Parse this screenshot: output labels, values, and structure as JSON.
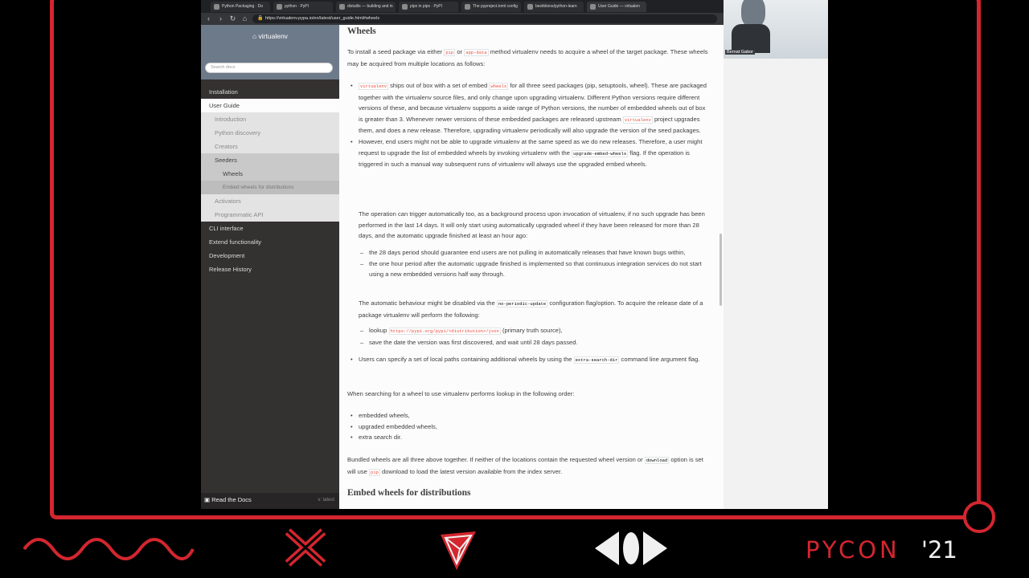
{
  "browser": {
    "tabs": [
      "Python Packaging · Do",
      "python · PyPI",
      "distutils — building and in",
      "pipx in pipx · PyPI",
      "The pypreject.toml config",
      "bestktions/python-learn",
      "User Guide — virtualen"
    ],
    "url": "https://virtualenv.pypa.io/en/latest/user_guide.html#wheels"
  },
  "sidebar": {
    "title": "virtualenv",
    "search_placeholder": "Search docs",
    "items": [
      {
        "label": "Installation",
        "level": 1
      },
      {
        "label": "User Guide",
        "level": 1,
        "current": true
      },
      {
        "label": "Introduction",
        "level": 2
      },
      {
        "label": "Python discovery",
        "level": 2
      },
      {
        "label": "Creators",
        "level": 2
      },
      {
        "label": "Seeders",
        "level": 2,
        "current": true
      },
      {
        "label": "Wheels",
        "level": 3
      },
      {
        "label": "Embed wheels for distributions",
        "level": 3
      },
      {
        "label": "Activators",
        "level": 2
      },
      {
        "label": "Programmatic API",
        "level": 2
      },
      {
        "label": "CLI interface",
        "level": 1
      },
      {
        "label": "Extend functionality",
        "level": 1
      },
      {
        "label": "Development",
        "level": 1
      },
      {
        "label": "Release History",
        "level": 1
      }
    ],
    "footer_label": "Read the Docs",
    "footer_version": "v: latest"
  },
  "content": {
    "heading": "Wheels",
    "intro_1": "To install a seed package via either ",
    "intro_code1": "pip",
    "intro_2": " or ",
    "intro_code2": "app-data",
    "intro_3": " method virtualenv needs to acquire a wheel of the target package. These wheels may be acquired from multiple locations as follows:",
    "b1_code1": "virtualenv",
    "b1_t1": " ships out of box with a set of embed ",
    "b1_code2": "wheels",
    "b1_t2": " for all three seed packages (pip, setuptools, wheel). These are packaged together with the virtualenv source files, and only change upon upgrading virtualenv. Different Python versions require different versions of these, and because virtualenv supports a wide range of Python versions, the number of embedded wheels out of box is greater than 3. Whenever newer versions of these embedded packages are released upstream ",
    "b1_code3": "virtualenv",
    "b1_t3": " project upgrades them, and does a new release. Therefore, upgrading virtualenv periodically will also upgrade the version of the seed packages.",
    "b2_t1": "However, end users might not be able to upgrade virtualenv at the same speed as we do new releases. Therefore, a user might request to upgrade the list of embedded wheels by invoking virtualenv with the ",
    "b2_code": "upgrade-embed-wheels",
    "b2_t2": " flag. If the operation is triggered in such a manual way subsequent runs of virtualenv will always use the upgraded embed wheels.",
    "p_auto": "The operation can trigger automatically too, as a background process upon invocation of virtualenv, if no such upgrade has been performed in the last 14 days. It will only start using automatically upgraded wheel if they have been released for more than 28 days, and the automatic upgrade finished at least an hour ago:",
    "dash1": "the 28 days period should guarantee end users are not pulling in automatically releases that have known bugs within,",
    "dash2": "the one hour period after the automatic upgrade finished is implemented so that continuous integration services do not start using a new embedded versions half way through.",
    "p_disable_1": "The automatic behaviour might be disabled via the ",
    "p_disable_code": "no-periodic-update",
    "p_disable_2": " configuration flag/option. To acquire the release date of a package virtualenv will perform the following:",
    "dash3_t1": "lookup ",
    "dash3_code": "https://pypi.org/pypi/<distribution>/json",
    "dash3_t2": " (primary truth source),",
    "dash4": "save the date the version was first discovered, and wait until 28 days passed.",
    "b3_t1": "Users can specify a set of local paths containing additional wheels by using the ",
    "b3_code": "extra-search-dir",
    "b3_t2": " command line argument flag.",
    "p_search": "When searching for a wheel to use virtualenv performs lookup in the following order:",
    "order": [
      "embedded wheels,",
      "upgraded embedded wheels,",
      "extra search dir."
    ],
    "p_bundled_1": "Bundled wheels are all three above together. If neither of the locations contain the requested wheel version or ",
    "p_bundled_code1": "download",
    "p_bundled_2": " option is set will use ",
    "p_bundled_code2": "pip",
    "p_bundled_3": " download to load the latest version available from the index server.",
    "heading2": "Embed wheels for distributions"
  },
  "webcam": {
    "name": "Bernat Gabor"
  },
  "branding": {
    "wordmark": "PYCON",
    "year": "'21",
    "accent_color": "#d3262f"
  }
}
